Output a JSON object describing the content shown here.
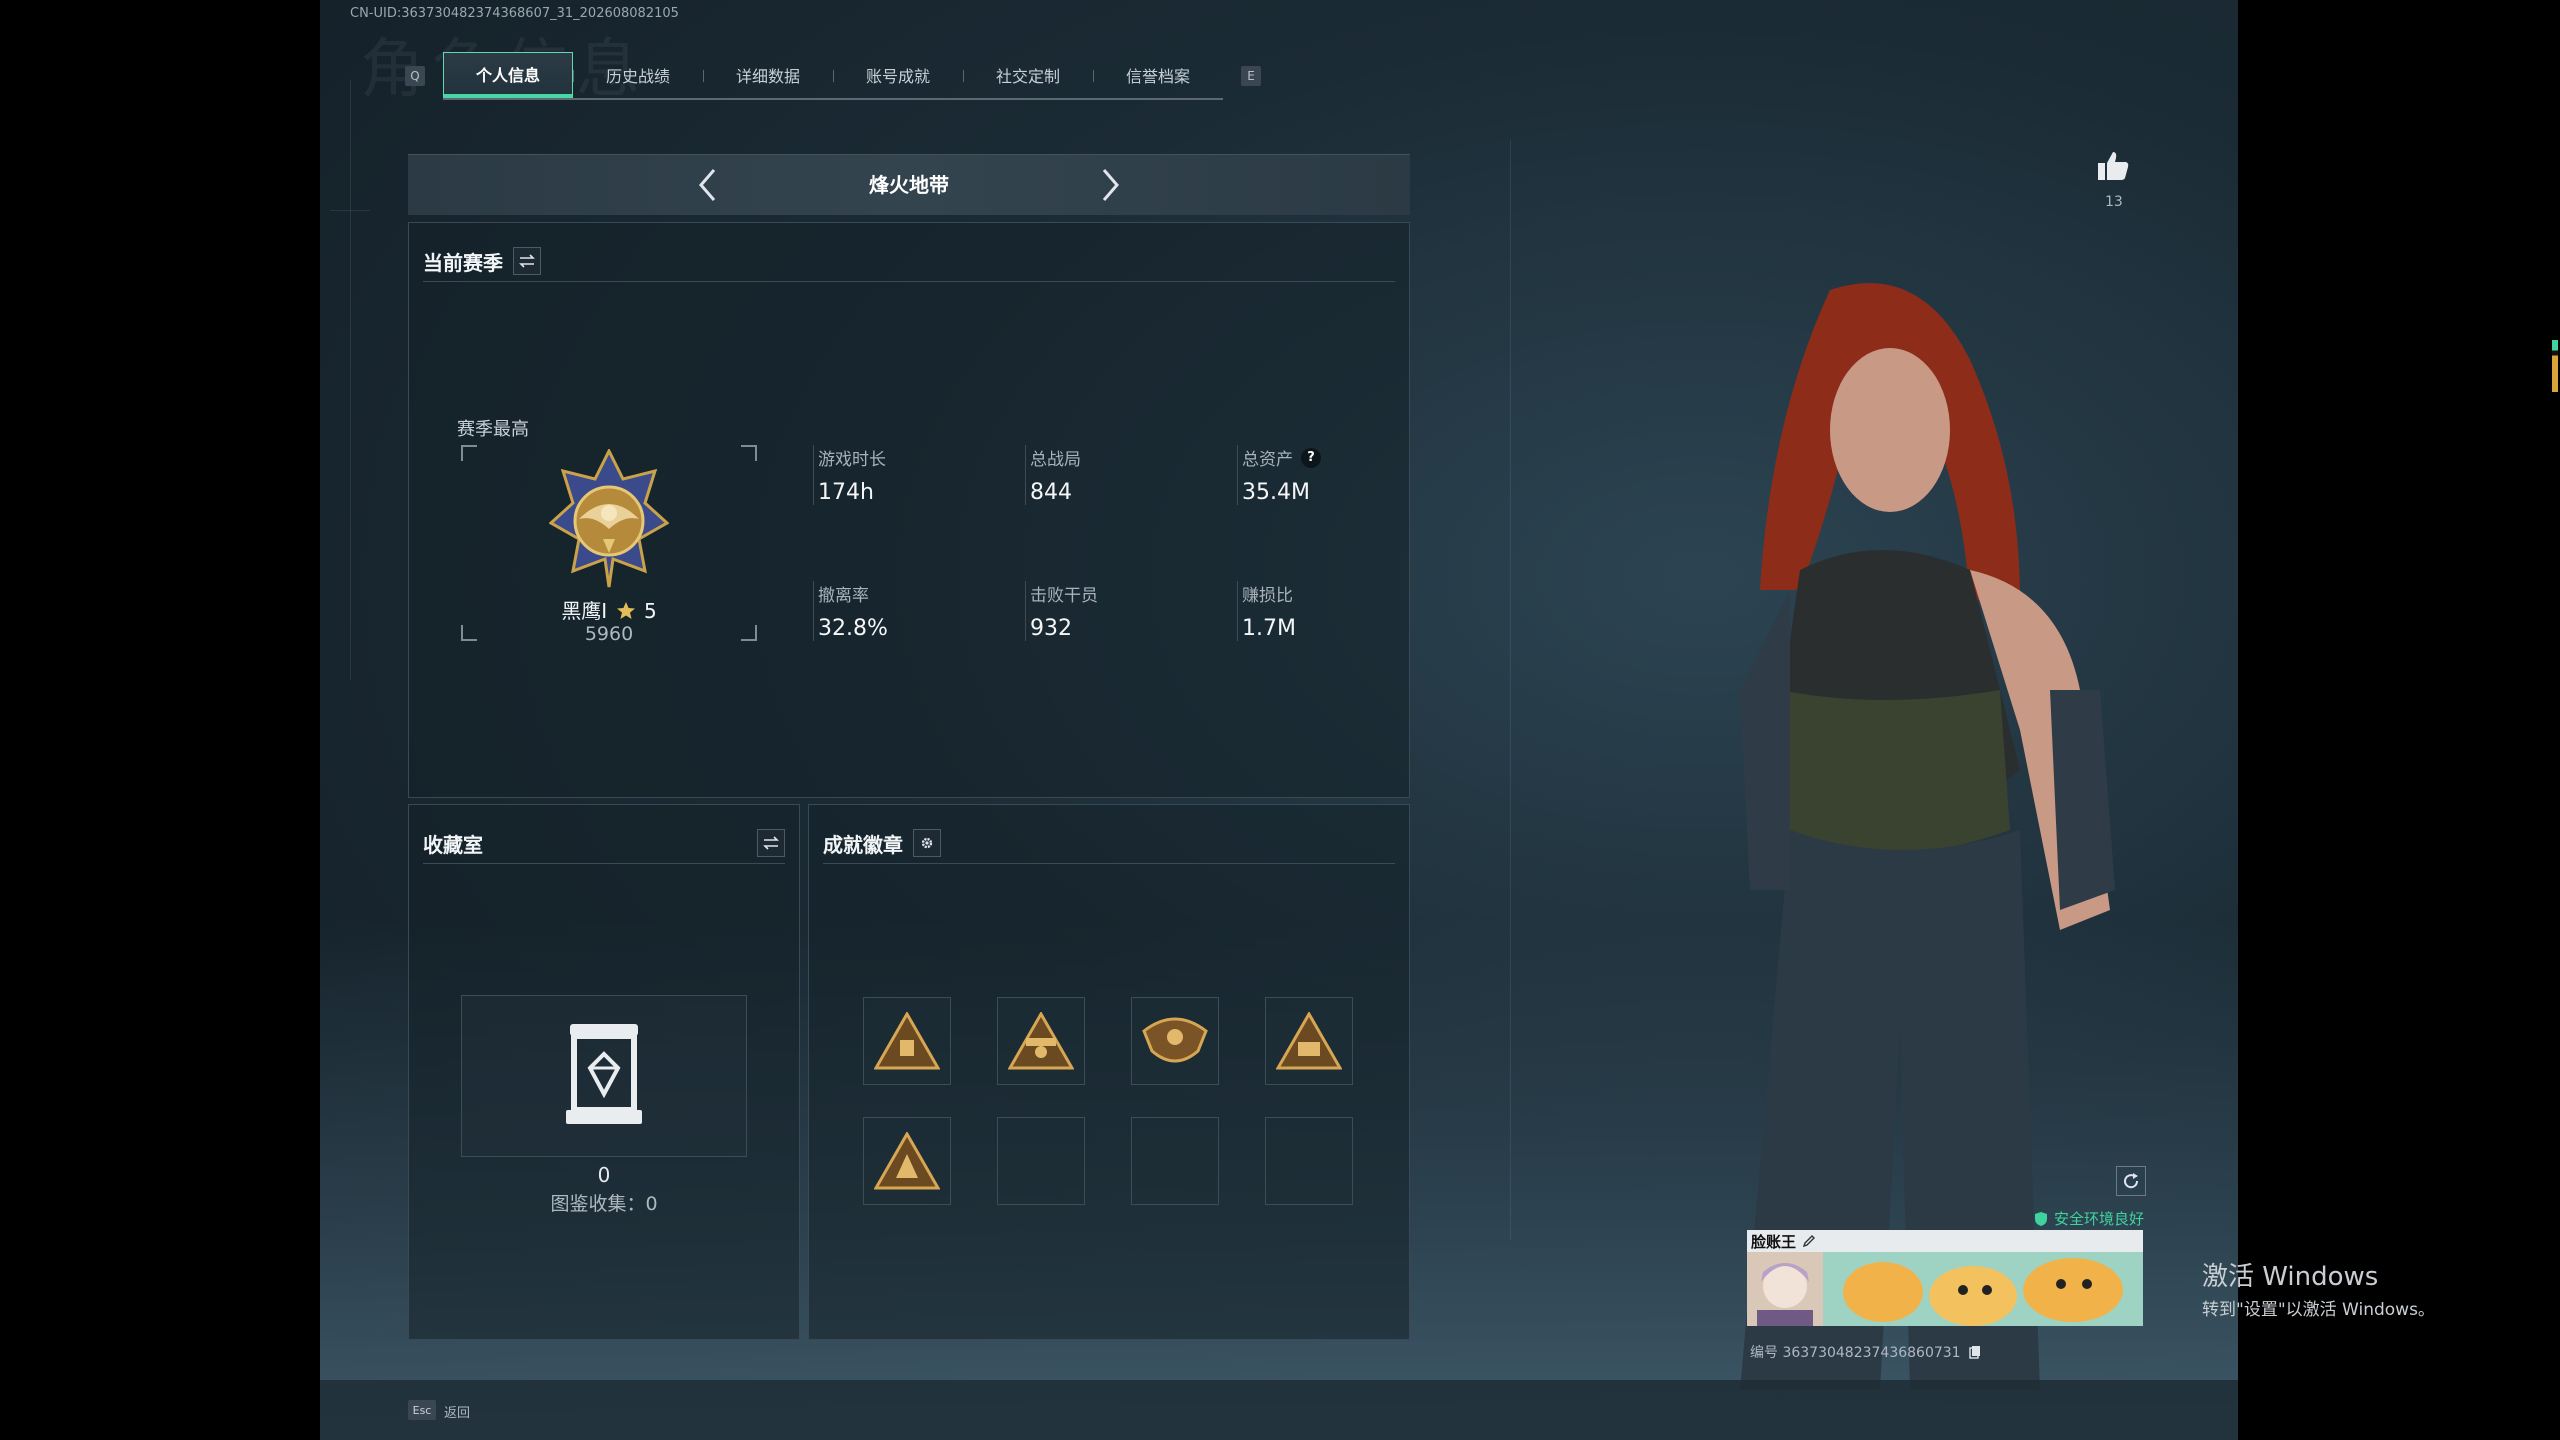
{
  "uid_text": "CN-UID:363730482374368607_31_202608082105",
  "ghost_title": "角色信息",
  "tabs": {
    "left_key": "Q",
    "right_key": "E",
    "items": [
      "个人信息",
      "历史战绩",
      "详细数据",
      "账号成就",
      "社交定制",
      "信誉档案"
    ],
    "active_index": 0
  },
  "map_selector": {
    "name": "烽火地带"
  },
  "current_season": {
    "title": "当前赛季",
    "best_label": "赛季最高",
    "rank_name": "黑鹰I",
    "rank_stars": "5",
    "rank_score": "5960",
    "stats": [
      {
        "label": "游戏时长",
        "value": "174h"
      },
      {
        "label": "总战局",
        "value": "844"
      },
      {
        "label": "总资产",
        "value": "35.4M",
        "has_help": true,
        "help_glyph": "?"
      },
      {
        "label": "撤离率",
        "value": "32.8%"
      },
      {
        "label": "击败干员",
        "value": "932"
      },
      {
        "label": "赚损比",
        "value": "1.7M"
      }
    ]
  },
  "collection": {
    "title": "收藏室",
    "count": "0",
    "atlas_label": "图鉴收集：0"
  },
  "achievements": {
    "title": "成就徽章",
    "badge_count_filled": 5,
    "slots_total": 8
  },
  "likes": {
    "count": "13"
  },
  "player_card": {
    "name": "脸账王",
    "env_status": "安全环境良好",
    "id_text": "编号 36373048237436860731"
  },
  "footer": {
    "esc_key": "Esc",
    "back_label": "返回"
  },
  "windows_activation": {
    "title": "激活 Windows",
    "subtitle": "转到\"设置\"以激活 Windows。"
  },
  "colors": {
    "accent": "#48d6a4",
    "panel_border": "#3a4954",
    "gold": "#c9a24a"
  }
}
